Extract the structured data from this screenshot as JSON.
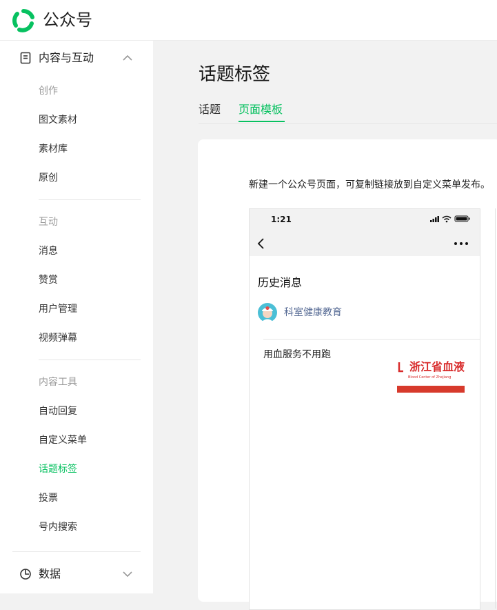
{
  "header": {
    "brand": "公众号"
  },
  "sidebar": {
    "section1": {
      "label": "内容与互动"
    },
    "group_create": {
      "label": "创作",
      "items": [
        "图文素材",
        "素材库",
        "原创"
      ]
    },
    "group_interact": {
      "label": "互动",
      "items": [
        "消息",
        "赞赏",
        "用户管理",
        "视频弹幕"
      ]
    },
    "group_tools": {
      "label": "内容工具",
      "items": [
        "自动回复",
        "自定义菜单",
        "话题标签",
        "投票",
        "号内搜索"
      ]
    },
    "active_item": "话题标签",
    "section2": {
      "label": "数据"
    }
  },
  "main": {
    "title": "话题标签",
    "tabs": [
      {
        "label": "话题"
      },
      {
        "label": "页面模板"
      }
    ],
    "active_tab": "页面模板",
    "description": "新建一个公众号页面，可复制链接放到自定义菜单发布。"
  },
  "phone": {
    "time": "1:21",
    "page_title": "历史消息",
    "account_name": "科室健康教育",
    "article_title": "用血服务不用跑",
    "thumb_title": "浙江省血液",
    "thumb_subtitle": "Blood Center of Zhejiang"
  },
  "colors": {
    "accent": "#07c160",
    "link": "#576b95",
    "thumb_red": "#d82b2b"
  }
}
